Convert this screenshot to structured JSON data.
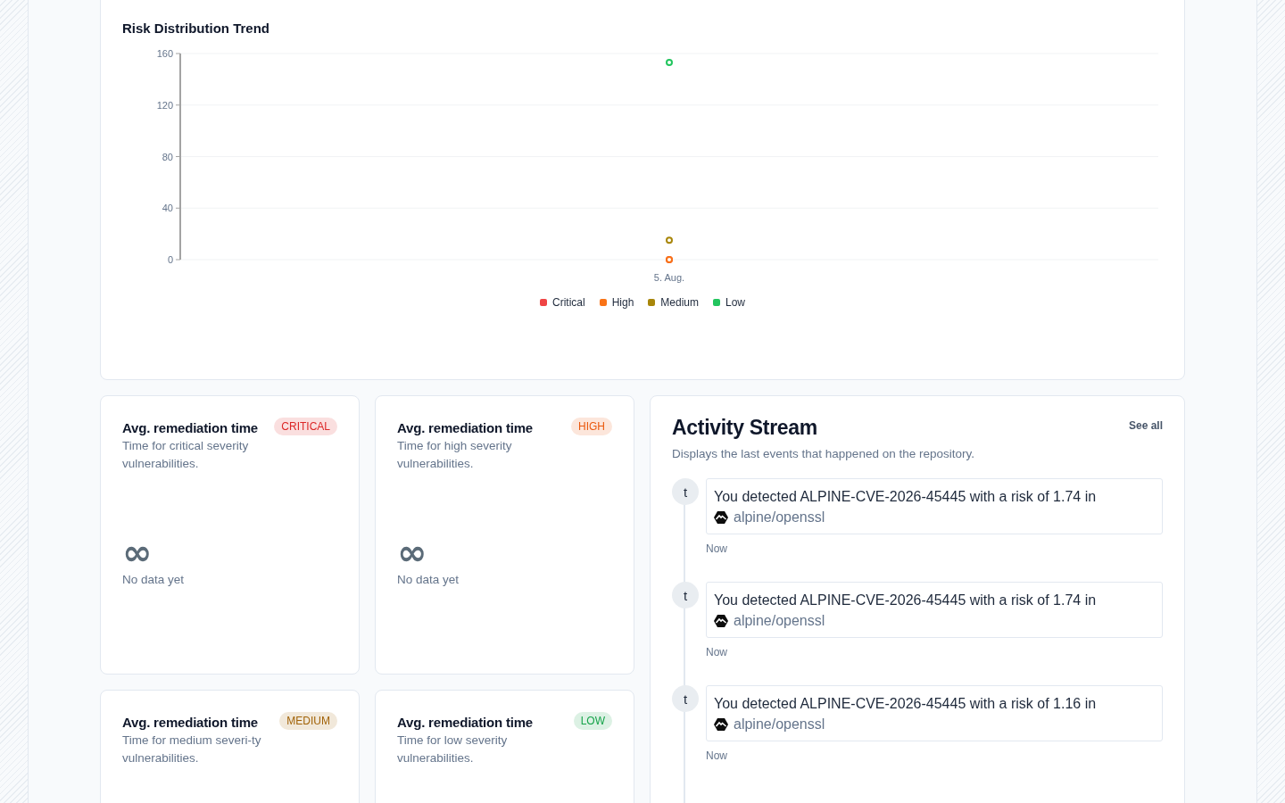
{
  "risk_chart": {
    "title": "Risk Distribution Trend",
    "chart_data": {
      "type": "scatter",
      "categories": [
        "5. Aug."
      ],
      "ylim": [
        0,
        160
      ],
      "yticks": [
        0,
        40,
        80,
        120,
        160
      ],
      "grid": true,
      "legend": true,
      "series": [
        {
          "name": "Critical",
          "color": "#ef4444",
          "values": [
            0
          ]
        },
        {
          "name": "High",
          "color": "#f97316",
          "values": [
            0
          ]
        },
        {
          "name": "Medium",
          "color": "#a8860a",
          "values": [
            15
          ]
        },
        {
          "name": "Low",
          "color": "#22c55e",
          "values": [
            153
          ]
        }
      ]
    }
  },
  "remediation_cards": [
    {
      "title": "Avg. remediation time",
      "color": "#dc2626",
      "badge": "CRITICAL",
      "description": "Time for critical severity vulnerabilities.",
      "value": "∞",
      "note": "No data yet"
    },
    {
      "title": "Avg. remediation time",
      "color": "#ea580c",
      "badge": "HIGH",
      "description": "Time for high severity vulnerabilities.",
      "value": "∞",
      "note": "No data yet"
    },
    {
      "title": "Avg. remediation time",
      "color": "#a16207",
      "badge": "MEDIUM",
      "description": "Time for medium severi-ty vulnerabilities."
    },
    {
      "title": "Avg. remediation time",
      "color": "#16a34a",
      "badge": "LOW",
      "description": "Time for low severity vulnerabilities."
    }
  ],
  "activity_stream": {
    "title": "Activity Stream",
    "see_all": "See all",
    "description": "Displays the last events that happened on the repository.",
    "events": [
      {
        "avatar": "t",
        "text": "You detected ALPINE-CVE-2026-45445 with a risk of 1.74 in",
        "repository": "alpine/openssl",
        "time": "Now"
      },
      {
        "avatar": "t",
        "text": "You detected ALPINE-CVE-2026-45445 with a risk of 1.74 in",
        "repository": "alpine/openssl",
        "time": "Now"
      },
      {
        "avatar": "t",
        "text": "You detected ALPINE-CVE-2026-45445 with a risk of 1.16 in",
        "repository": "alpine/openssl",
        "time": "Now"
      }
    ]
  }
}
